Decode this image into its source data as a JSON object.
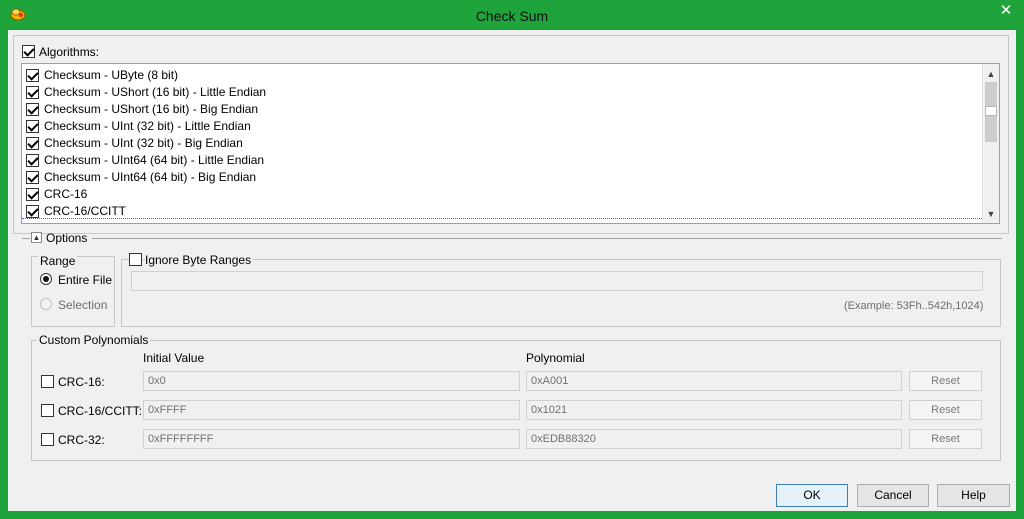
{
  "window": {
    "title": "Check Sum",
    "close_glyph": "✕"
  },
  "algorithms": {
    "label": "Algorithms:",
    "checked": true,
    "items": [
      {
        "label": "Checksum - UByte (8 bit)",
        "checked": true
      },
      {
        "label": "Checksum - UShort (16 bit) - Little Endian",
        "checked": true
      },
      {
        "label": "Checksum - UShort (16 bit) - Big Endian",
        "checked": true
      },
      {
        "label": "Checksum - UInt (32 bit) - Little Endian",
        "checked": true
      },
      {
        "label": "Checksum - UInt (32 bit) - Big Endian",
        "checked": true
      },
      {
        "label": "Checksum - UInt64 (64 bit) - Little Endian",
        "checked": true
      },
      {
        "label": "Checksum - UInt64 (64 bit) - Big Endian",
        "checked": true
      },
      {
        "label": "CRC-16",
        "checked": true
      },
      {
        "label": "CRC-16/CCITT",
        "checked": true
      }
    ]
  },
  "options": {
    "label": "Options",
    "range": {
      "label": "Range",
      "entire_file": "Entire File",
      "selection": "Selection",
      "selected": "Entire File"
    },
    "ignore_byte_ranges": {
      "label": "Ignore Byte Ranges",
      "checked": false,
      "value": "",
      "example": "(Example: 53Fh..542h,1024)"
    },
    "custom_polynomials": {
      "label": "Custom Polynomials",
      "col_initial": "Initial Value",
      "col_polynomial": "Polynomial",
      "rows": [
        {
          "name": "CRC-16:",
          "initial": "0x0",
          "polynomial": "0xA001",
          "reset": "Reset"
        },
        {
          "name": "CRC-16/CCITT:",
          "initial": "0xFFFF",
          "polynomial": "0x1021",
          "reset": "Reset"
        },
        {
          "name": "CRC-32:",
          "initial": "0xFFFFFFFF",
          "polynomial": "0xEDB88320",
          "reset": "Reset"
        }
      ]
    }
  },
  "buttons": {
    "ok": "OK",
    "cancel": "Cancel",
    "help": "Help"
  }
}
